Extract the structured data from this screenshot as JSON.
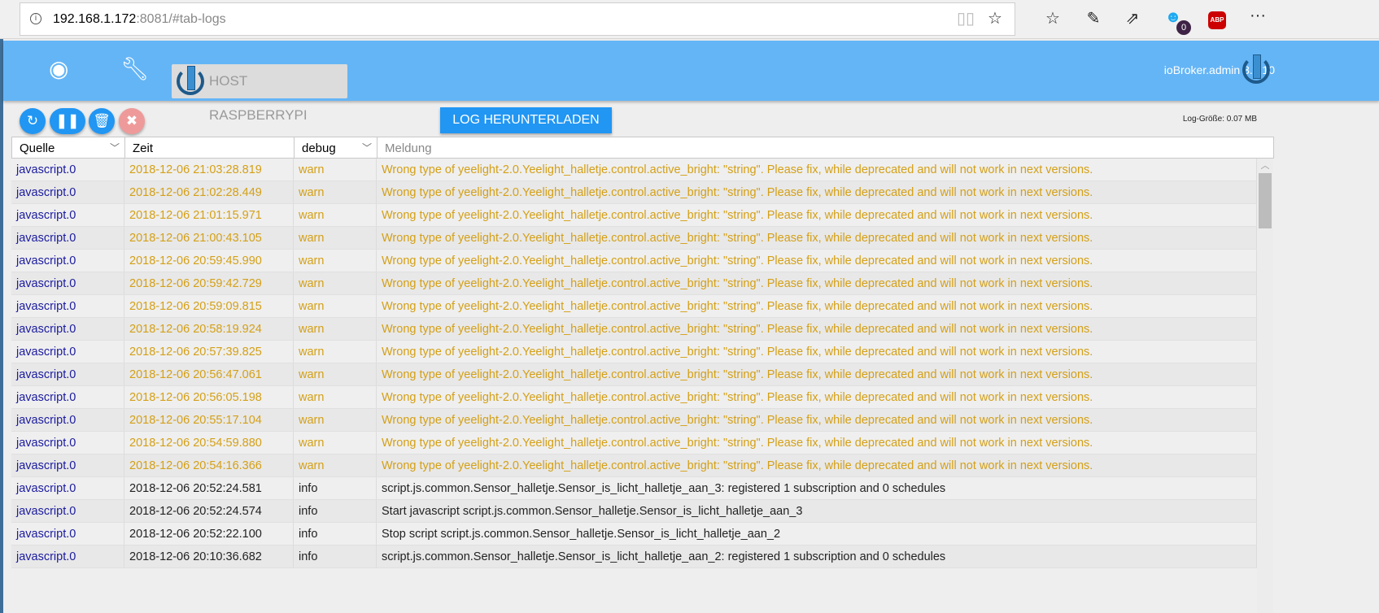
{
  "browser": {
    "url_host": "192.168.1.172",
    "url_rest": ":8081/#tab-logs",
    "badge_count": "0",
    "abp_label": "ABP",
    "more": "···"
  },
  "header": {
    "host_button": "HOST RASPBERRYPI",
    "version": "ioBroker.admin 3.5.10"
  },
  "toolbar": {
    "download_label": "LOG HERUNTERLADEN",
    "log_size": "Log-Größe: 0.07 MB"
  },
  "columns": {
    "source": "Quelle",
    "time": "Zeit",
    "level": "debug",
    "message": "Meldung"
  },
  "colors": {
    "header": "#64b5f6",
    "button": "#2196f3",
    "warn": "#d4a017",
    "source": "#1a1aa0"
  },
  "rows": [
    {
      "source": "javascript.0",
      "time": "2018-12-06 21:03:28.819",
      "level": "warn",
      "message": "Wrong type of yeelight-2.0.Yeelight_halletje.control.active_bright: \"string\". Please fix, while deprecated and will not work in next versions."
    },
    {
      "source": "javascript.0",
      "time": "2018-12-06 21:02:28.449",
      "level": "warn",
      "message": "Wrong type of yeelight-2.0.Yeelight_halletje.control.active_bright: \"string\". Please fix, while deprecated and will not work in next versions."
    },
    {
      "source": "javascript.0",
      "time": "2018-12-06 21:01:15.971",
      "level": "warn",
      "message": "Wrong type of yeelight-2.0.Yeelight_halletje.control.active_bright: \"string\". Please fix, while deprecated and will not work in next versions."
    },
    {
      "source": "javascript.0",
      "time": "2018-12-06 21:00:43.105",
      "level": "warn",
      "message": "Wrong type of yeelight-2.0.Yeelight_halletje.control.active_bright: \"string\". Please fix, while deprecated and will not work in next versions."
    },
    {
      "source": "javascript.0",
      "time": "2018-12-06 20:59:45.990",
      "level": "warn",
      "message": "Wrong type of yeelight-2.0.Yeelight_halletje.control.active_bright: \"string\". Please fix, while deprecated and will not work in next versions."
    },
    {
      "source": "javascript.0",
      "time": "2018-12-06 20:59:42.729",
      "level": "warn",
      "message": "Wrong type of yeelight-2.0.Yeelight_halletje.control.active_bright: \"string\". Please fix, while deprecated and will not work in next versions."
    },
    {
      "source": "javascript.0",
      "time": "2018-12-06 20:59:09.815",
      "level": "warn",
      "message": "Wrong type of yeelight-2.0.Yeelight_halletje.control.active_bright: \"string\". Please fix, while deprecated and will not work in next versions."
    },
    {
      "source": "javascript.0",
      "time": "2018-12-06 20:58:19.924",
      "level": "warn",
      "message": "Wrong type of yeelight-2.0.Yeelight_halletje.control.active_bright: \"string\". Please fix, while deprecated and will not work in next versions."
    },
    {
      "source": "javascript.0",
      "time": "2018-12-06 20:57:39.825",
      "level": "warn",
      "message": "Wrong type of yeelight-2.0.Yeelight_halletje.control.active_bright: \"string\". Please fix, while deprecated and will not work in next versions."
    },
    {
      "source": "javascript.0",
      "time": "2018-12-06 20:56:47.061",
      "level": "warn",
      "message": "Wrong type of yeelight-2.0.Yeelight_halletje.control.active_bright: \"string\". Please fix, while deprecated and will not work in next versions."
    },
    {
      "source": "javascript.0",
      "time": "2018-12-06 20:56:05.198",
      "level": "warn",
      "message": "Wrong type of yeelight-2.0.Yeelight_halletje.control.active_bright: \"string\". Please fix, while deprecated and will not work in next versions."
    },
    {
      "source": "javascript.0",
      "time": "2018-12-06 20:55:17.104",
      "level": "warn",
      "message": "Wrong type of yeelight-2.0.Yeelight_halletje.control.active_bright: \"string\". Please fix, while deprecated and will not work in next versions."
    },
    {
      "source": "javascript.0",
      "time": "2018-12-06 20:54:59.880",
      "level": "warn",
      "message": "Wrong type of yeelight-2.0.Yeelight_halletje.control.active_bright: \"string\". Please fix, while deprecated and will not work in next versions."
    },
    {
      "source": "javascript.0",
      "time": "2018-12-06 20:54:16.366",
      "level": "warn",
      "message": "Wrong type of yeelight-2.0.Yeelight_halletje.control.active_bright: \"string\". Please fix, while deprecated and will not work in next versions."
    },
    {
      "source": "javascript.0",
      "time": "2018-12-06 20:52:24.581",
      "level": "info",
      "message": "script.js.common.Sensor_halletje.Sensor_is_licht_halletje_aan_3: registered 1 subscription and 0 schedules"
    },
    {
      "source": "javascript.0",
      "time": "2018-12-06 20:52:24.574",
      "level": "info",
      "message": "Start javascript script.js.common.Sensor_halletje.Sensor_is_licht_halletje_aan_3"
    },
    {
      "source": "javascript.0",
      "time": "2018-12-06 20:52:22.100",
      "level": "info",
      "message": "Stop script script.js.common.Sensor_halletje.Sensor_is_licht_halletje_aan_2"
    },
    {
      "source": "javascript.0",
      "time": "2018-12-06 20:10:36.682",
      "level": "info",
      "message": "script.js.common.Sensor_halletje.Sensor_is_licht_halletje_aan_2: registered 1 subscription and 0 schedules"
    }
  ]
}
